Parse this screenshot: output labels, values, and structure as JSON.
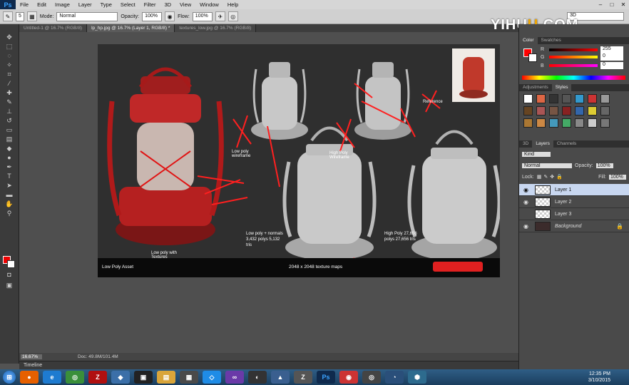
{
  "app": {
    "logo": "Ps"
  },
  "menu": [
    "File",
    "Edit",
    "Image",
    "Layer",
    "Type",
    "Select",
    "Filter",
    "3D",
    "View",
    "Window",
    "Help"
  ],
  "options": {
    "size": "5",
    "mode_label": "Mode:",
    "mode_value": "Normal",
    "opacity_label": "Opacity:",
    "opacity_value": "100%",
    "flow_label": "Flow:",
    "flow_value": "100%"
  },
  "workspace": "3D",
  "watermark": {
    "part1": "YIHU",
    "part2": "U",
    "part3": ".COM"
  },
  "tabs": [
    {
      "label": "Untitled-1 @ 16.7% (RGB/8)"
    },
    {
      "label": "lp_hp.jpg @ 16.7% (Layer 1, RGB/8) *"
    },
    {
      "label": "textures_low.jpg @ 16.7% (RGB/8)"
    }
  ],
  "image_text": {
    "low_wire": "Low poly wireframe",
    "high_wire": "High Poly Wireframe",
    "reference": "Reference",
    "low_textures": "Low poly with Textures",
    "low_normals": "Low poly + normals 3,432 polys 5,132 tris",
    "high_poly": "High Poly 27,656 polys 27,656 tris",
    "low_asset": "Low Poly Asset",
    "texture_maps": "2048 x 2048 texture maps"
  },
  "status": {
    "zoom": "16.67%",
    "doc": "Doc: 49.8M/101.4M"
  },
  "timeline": "Timeline",
  "color_panel": {
    "tabs": [
      "Color",
      "Swatches"
    ],
    "r_label": "R",
    "r": "255",
    "g_label": "G",
    "g": "0",
    "b_label": "B",
    "b": "0"
  },
  "styles_panel": {
    "tabs": [
      "Adjustments",
      "Styles"
    ]
  },
  "layers_panel": {
    "tabs": [
      "3D",
      "Layers",
      "Channels"
    ],
    "kind": "Kind",
    "blend": "Normal",
    "opacity_label": "Opacity:",
    "opacity": "100%",
    "lock_label": "Lock:",
    "fill_label": "Fill:",
    "fill": "100%",
    "layers": [
      {
        "name": "Layer 1"
      },
      {
        "name": "Layer 2"
      },
      {
        "name": "Layer 3"
      },
      {
        "name": "Background"
      }
    ]
  },
  "taskbar": {
    "apps": [
      "start-orb",
      "firefox",
      "ie",
      "chrome",
      "filezilla",
      "app",
      "app",
      "explorer",
      "app",
      "dropbox",
      "vs",
      "app",
      "3ds",
      "zbrush",
      "photoshop",
      "app",
      "app",
      "app",
      "3dsmax"
    ],
    "time": "12:35 PM",
    "date": "3/10/2015"
  },
  "colors": {
    "accent_fg": "#ff0000",
    "taskbar": "#2f5e86"
  }
}
